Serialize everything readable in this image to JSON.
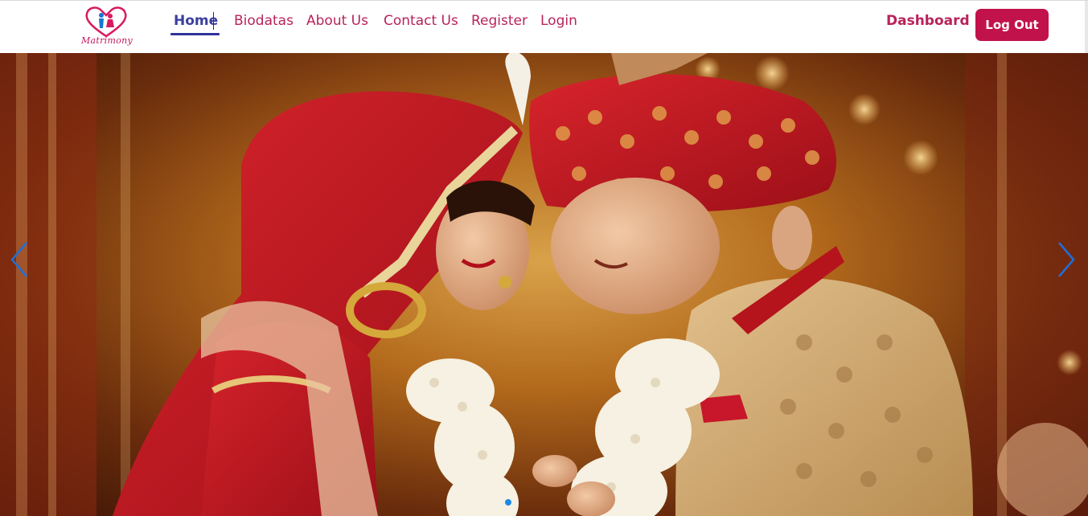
{
  "brand": {
    "logo_text": "Matrimony"
  },
  "nav": {
    "links": [
      {
        "label": "Home",
        "active": true
      },
      {
        "label": "Biodatas"
      },
      {
        "label": "About Us"
      },
      {
        "label": "Contact Us"
      },
      {
        "label": "Register"
      },
      {
        "label": "Login"
      }
    ],
    "dashboard_label": "Dashboard",
    "logout_label": "Log Out"
  },
  "hero": {
    "image_subject": "wedding-couple-photo",
    "slides_count": 1,
    "active_slide": 1,
    "prev_icon": "chevron-left-icon",
    "next_icon": "chevron-right-icon"
  },
  "colors": {
    "brand": "#b8235a",
    "active_nav": "#3b3fa0",
    "button": "#c2124c",
    "arrow": "#1e6fd9"
  }
}
